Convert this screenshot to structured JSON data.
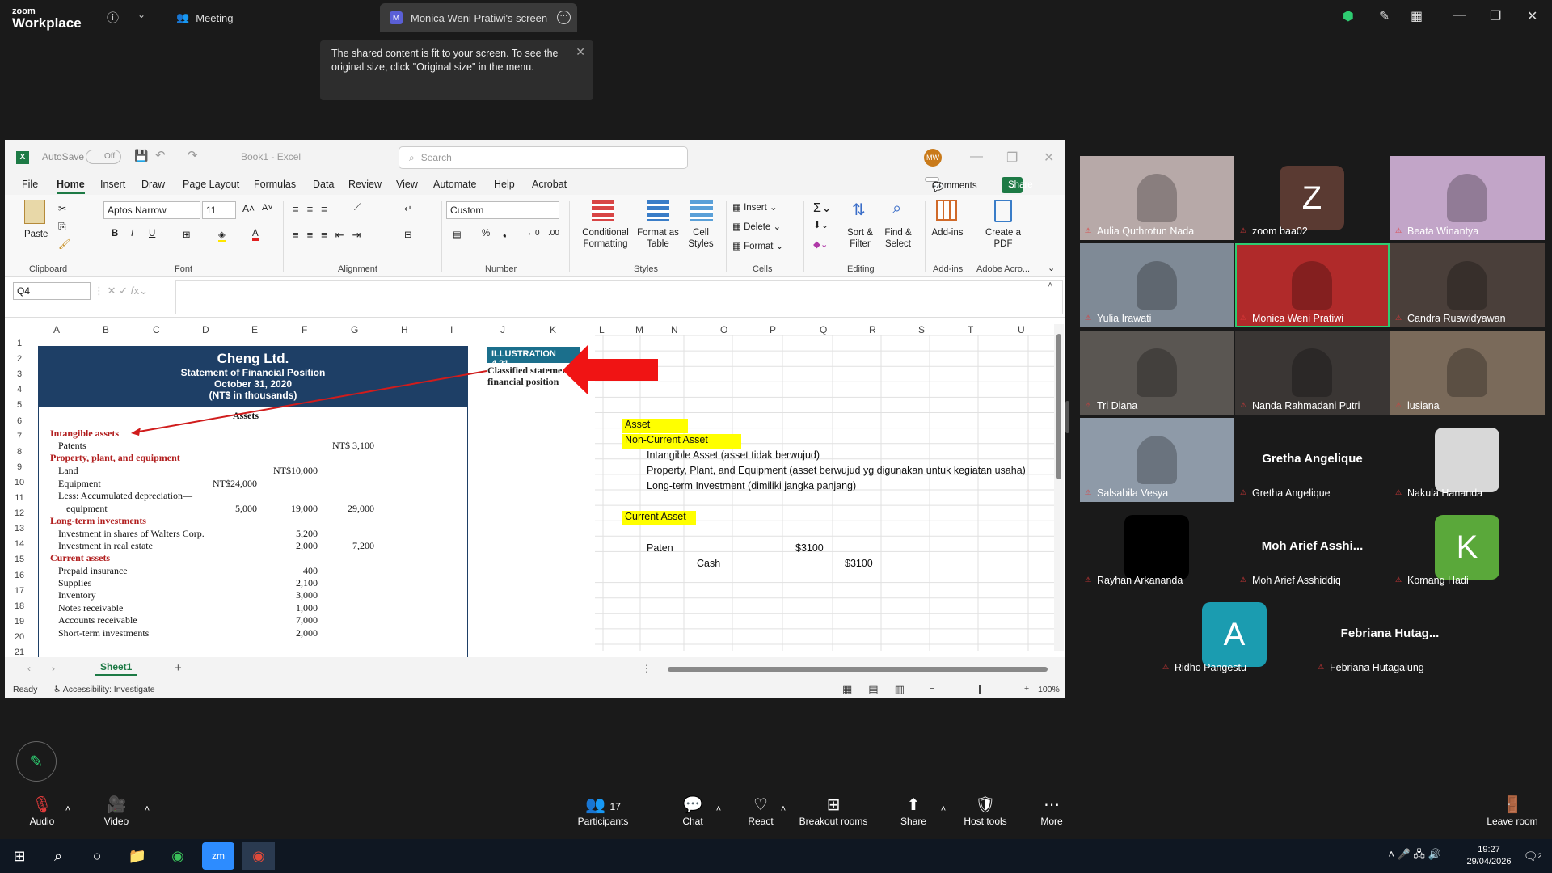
{
  "zoom": {
    "logo_small": "zoom",
    "logo_big": "Workplace",
    "meeting_label": "Meeting",
    "screen_tab": "Monica Weni Pratiwi's screen",
    "screen_tab_badge": "M",
    "tooltip": "The shared content is fit to your screen. To see the original size, click \"Original size\" in the menu."
  },
  "excel": {
    "autosave": "AutoSave",
    "autosave_state": "Off",
    "title": "Book1 - Excel",
    "search_placeholder": "Search",
    "user_initials": "MW",
    "menus": [
      "File",
      "Home",
      "Insert",
      "Draw",
      "Page Layout",
      "Formulas",
      "Data",
      "Review",
      "View",
      "Automate",
      "Help",
      "Acrobat"
    ],
    "comments": "Comments",
    "share": "Share",
    "ribbon": {
      "paste": "Paste",
      "clipboard": "Clipboard",
      "font_name": "Aptos Narrow",
      "font_size": "11",
      "font_group": "Font",
      "alignment_group": "Alignment",
      "number_format": "Custom",
      "number_group": "Number",
      "conditional": "Conditional Formatting",
      "format_table": "Format as Table",
      "cell_styles": "Cell Styles",
      "styles_group": "Styles",
      "insert": "Insert",
      "delete": "Delete",
      "format": "Format",
      "cells_group": "Cells",
      "sort_filter": "Sort & Filter",
      "find_select": "Find & Select",
      "editing_group": "Editing",
      "addins": "Add-ins",
      "addins_group": "Add-ins",
      "create_pdf": "Create a PDF",
      "adobe_group": "Adobe Acro..."
    },
    "name_box": "Q4",
    "columns": [
      "A",
      "B",
      "C",
      "D",
      "E",
      "F",
      "G",
      "H",
      "I",
      "J",
      "K",
      "L",
      "M",
      "N",
      "O",
      "P",
      "Q",
      "R",
      "S",
      "T",
      "U"
    ],
    "rows": [
      "1",
      "2",
      "3",
      "4",
      "5",
      "6",
      "7",
      "8",
      "9",
      "10",
      "11",
      "12",
      "13",
      "14",
      "15",
      "16",
      "17",
      "18",
      "19",
      "20",
      "21"
    ],
    "cells": {
      "asset": "Asset",
      "noncurrent": "Non-Current Asset",
      "intangible": "Intangible Asset (asset tidak berwujud)",
      "ppe": "Property, Plant, and Equipment (asset berwujud yg digunakan untuk kegiatan usaha)",
      "lti": "Long-term Investment (dimiliki jangka panjang)",
      "current": "Current Asset",
      "paten": "Paten",
      "paten_val": "$3100",
      "cash": "Cash",
      "cash_val": "$3100"
    },
    "sheet_tab": "Sheet1",
    "status_ready": "Ready",
    "accessibility": "Accessibility: Investigate",
    "zoom_level": "100%"
  },
  "book": {
    "company": "Cheng Ltd.",
    "statement": "Statement of Financial Position",
    "date": "October 31, 2020",
    "units": "(NT$ in thousands)",
    "assets": "Assets",
    "illustration": "ILLUSTRATION 4.21",
    "caption": "Classified statement of financial position",
    "lines": [
      {
        "label": "Intangible assets",
        "cls": "h"
      },
      {
        "label": "Patents",
        "c3": "NT$  3,100"
      },
      {
        "label": "Property, plant, and equipment",
        "cls": "h"
      },
      {
        "label": "Land",
        "c2": "NT$10,000"
      },
      {
        "label": "Equipment",
        "c1": "NT$24,000"
      },
      {
        "label": "Less: Accumulated depreciation—"
      },
      {
        "label": "equipment",
        "c1": "5,000",
        "c2": "19,000",
        "c3": "29,000",
        "indent": true
      },
      {
        "label": "Long-term investments",
        "cls": "h"
      },
      {
        "label": "Investment in shares of Walters Corp.",
        "c2": "5,200"
      },
      {
        "label": "Investment in real estate",
        "c2": "2,000",
        "c3": "7,200"
      },
      {
        "label": "Current assets",
        "cls": "h"
      },
      {
        "label": "Prepaid insurance",
        "c2": "400"
      },
      {
        "label": "Supplies",
        "c2": "2,100"
      },
      {
        "label": "Inventory",
        "c2": "3,000"
      },
      {
        "label": "Notes receivable",
        "c2": "1,000"
      },
      {
        "label": "Accounts receivable",
        "c2": "7,000"
      },
      {
        "label": "Short-term investments",
        "c2": "2,000"
      }
    ]
  },
  "participants": [
    {
      "name": "Aulia Quthrotun Nada",
      "type": "video"
    },
    {
      "name": "zoom baa02",
      "type": "avatar",
      "letter": "Z",
      "color": "#5a3a32"
    },
    {
      "name": "Beata Winantya",
      "type": "video"
    },
    {
      "name": "Yulia Irawati",
      "type": "video"
    },
    {
      "name": "Monica Weni Pratiwi",
      "type": "video"
    },
    {
      "name": "Candra Ruswidyawan",
      "type": "video"
    },
    {
      "name": "Tri Diana",
      "type": "video"
    },
    {
      "name": "Nanda Rahmadani Putri",
      "type": "video"
    },
    {
      "name": "lusiana",
      "type": "video"
    },
    {
      "name": "Salsabila Vesya",
      "type": "video"
    },
    {
      "name": "Gretha Angelique",
      "type": "text",
      "big": "Gretha Angelique"
    },
    {
      "name": "Nakula Hananda",
      "type": "photo"
    },
    {
      "name": "Rayhan Arkananda",
      "type": "black"
    },
    {
      "name": "Moh Arief Asshiddiq",
      "type": "text",
      "big": "Moh Arief Asshi..."
    },
    {
      "name": "Komang Hadi",
      "type": "avatar",
      "letter": "K",
      "color": "#5aa83a"
    },
    {
      "name": "Ridho Pangestu",
      "type": "avatar",
      "letter": "A",
      "color": "#1b9cb0"
    },
    {
      "name": "Febriana Hutagalung",
      "type": "text",
      "big": "Febriana  Hutag..."
    }
  ],
  "bottombar": {
    "audio": "Audio",
    "video": "Video",
    "participants": "Participants",
    "participants_count": "17",
    "chat": "Chat",
    "react": "React",
    "breakout": "Breakout rooms",
    "share": "Share",
    "host": "Host tools",
    "more": "More",
    "leave": "Leave room"
  },
  "taskbar": {
    "time": "19:27",
    "date": "29/04/2026",
    "notif": "2"
  }
}
